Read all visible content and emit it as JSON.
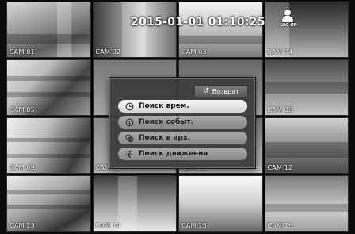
{
  "timestamp": "2015-01-01 01:10:25",
  "logo_text": "LOG ON",
  "cameras": [
    {
      "label": "CAM 01"
    },
    {
      "label": "CAM 02"
    },
    {
      "label": "CAM 03"
    },
    {
      "label": "CAM 04"
    },
    {
      "label": "CAM 05"
    },
    {
      "label": ""
    },
    {
      "label": ""
    },
    {
      "label": "CAM 08"
    },
    {
      "label": "CAM 09"
    },
    {
      "label": "CAM 10"
    },
    {
      "label": "CAM 11"
    },
    {
      "label": "CAM 12"
    },
    {
      "label": "CAM 13"
    },
    {
      "label": "CAM 14"
    },
    {
      "label": "CAM 15"
    },
    {
      "label": "CAM 16"
    }
  ],
  "menu": {
    "back_label": "Возврат",
    "items": [
      {
        "label": "Поиск врем.",
        "icon": "clock-icon",
        "active": true
      },
      {
        "label": "Поиск событ.",
        "icon": "event-icon",
        "active": false
      },
      {
        "label": "Поиск в арх.",
        "icon": "archive-icon",
        "active": false
      },
      {
        "label": "Поиск движения",
        "icon": "motion-icon",
        "active": false
      }
    ]
  }
}
